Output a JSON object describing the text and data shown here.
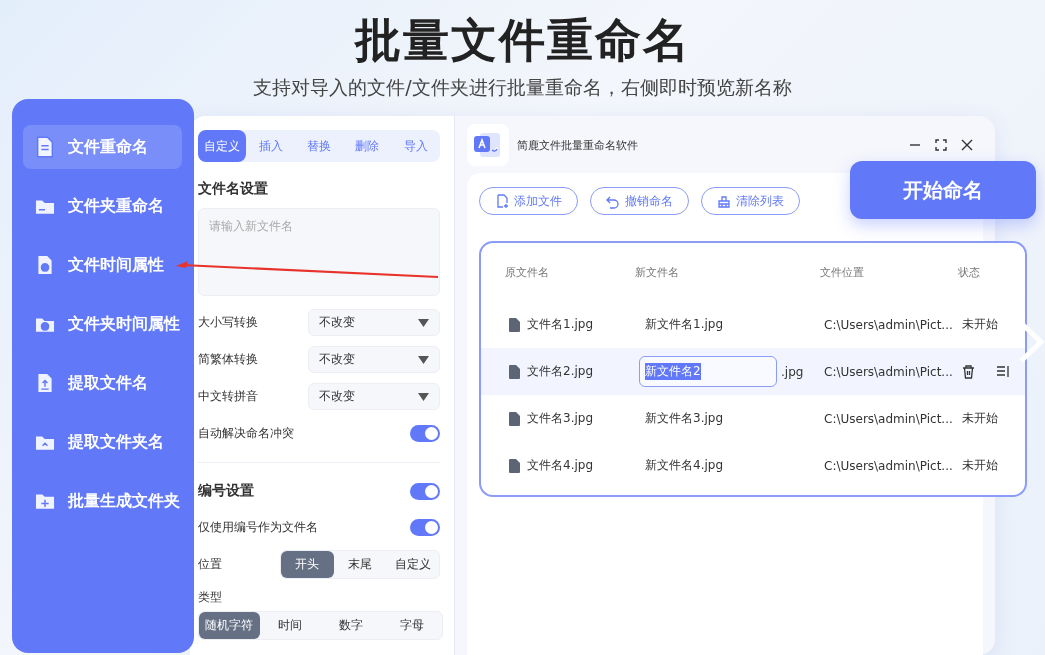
{
  "header": {
    "title": "批量文件重命名",
    "subtitle": "支持对导入的文件/文件夹进行批量重命名，右侧即时预览新名称"
  },
  "sidebar": {
    "items": [
      {
        "label": "文件重命名",
        "selected": true
      },
      {
        "label": "文件夹重命名",
        "selected": false
      },
      {
        "label": "文件时间属性",
        "selected": false
      },
      {
        "label": "文件夹时间属性",
        "selected": false
      },
      {
        "label": "提取文件名",
        "selected": false
      },
      {
        "label": "提取文件夹名",
        "selected": false
      },
      {
        "label": "批量生成文件夹",
        "selected": false
      }
    ]
  },
  "settings": {
    "tabs": [
      {
        "label": "自定义",
        "selected": true
      },
      {
        "label": "插入",
        "selected": false
      },
      {
        "label": "替换",
        "selected": false
      },
      {
        "label": "删除",
        "selected": false
      },
      {
        "label": "导入",
        "selected": false
      }
    ],
    "filename_title": "文件名设置",
    "filename_placeholder": "请输入新文件名",
    "options": [
      {
        "kind": "select",
        "label": "大小写转换",
        "value": "不改变"
      },
      {
        "kind": "select",
        "label": "简繁体转换",
        "value": "不改变"
      },
      {
        "kind": "select",
        "label": "中文转拼音",
        "value": "不改变"
      },
      {
        "kind": "toggle",
        "label": "自动解决命名冲突",
        "on": true
      }
    ],
    "numbering": {
      "title": "编号设置",
      "on": true,
      "options": [
        {
          "kind": "toggle",
          "label": "仅使用编号作为文件名",
          "on": true
        },
        {
          "kind": "segmented",
          "label": "位置",
          "choices": [
            {
              "label": "开头",
              "selected": true
            },
            {
              "label": "末尾",
              "selected": false
            },
            {
              "label": "自定义",
              "selected": false
            }
          ]
        }
      ],
      "type_label": "类型",
      "type_choices": [
        {
          "label": "随机字符",
          "selected": true
        },
        {
          "label": "时间",
          "selected": false
        },
        {
          "label": "数字",
          "selected": false
        },
        {
          "label": "字母",
          "selected": false
        }
      ]
    }
  },
  "app": {
    "title": "简鹿文件批量重命名软件",
    "toolbar": [
      {
        "label": "添加文件"
      },
      {
        "label": "撤销命名"
      },
      {
        "label": "清除列表"
      }
    ],
    "start_button": "开始命名",
    "table": {
      "columns": [
        "原文件名",
        "新文件名",
        "文件位置",
        "状态"
      ],
      "rows": [
        {
          "kind": "static",
          "selected": false,
          "original": "文件名1.jpg",
          "new": "新文件名1.jpg",
          "location": "C:\\Users\\admin\\Pict...",
          "status": "未开始"
        },
        {
          "kind": "editing",
          "selected": true,
          "original": "文件名2.jpg",
          "new": "新文件名2",
          "extension": ".jpg",
          "location": "C:\\Users\\admin\\Pict..."
        },
        {
          "kind": "static",
          "selected": false,
          "original": "文件名3.jpg",
          "new": "新文件名3.jpg",
          "location": "C:\\Users\\admin\\Pict...",
          "status": "未开始"
        },
        {
          "kind": "static",
          "selected": false,
          "original": "文件名4.jpg",
          "new": "新文件名4.jpg",
          "location": "C:\\Users\\admin\\Pict...",
          "status": "未开始"
        }
      ]
    }
  }
}
